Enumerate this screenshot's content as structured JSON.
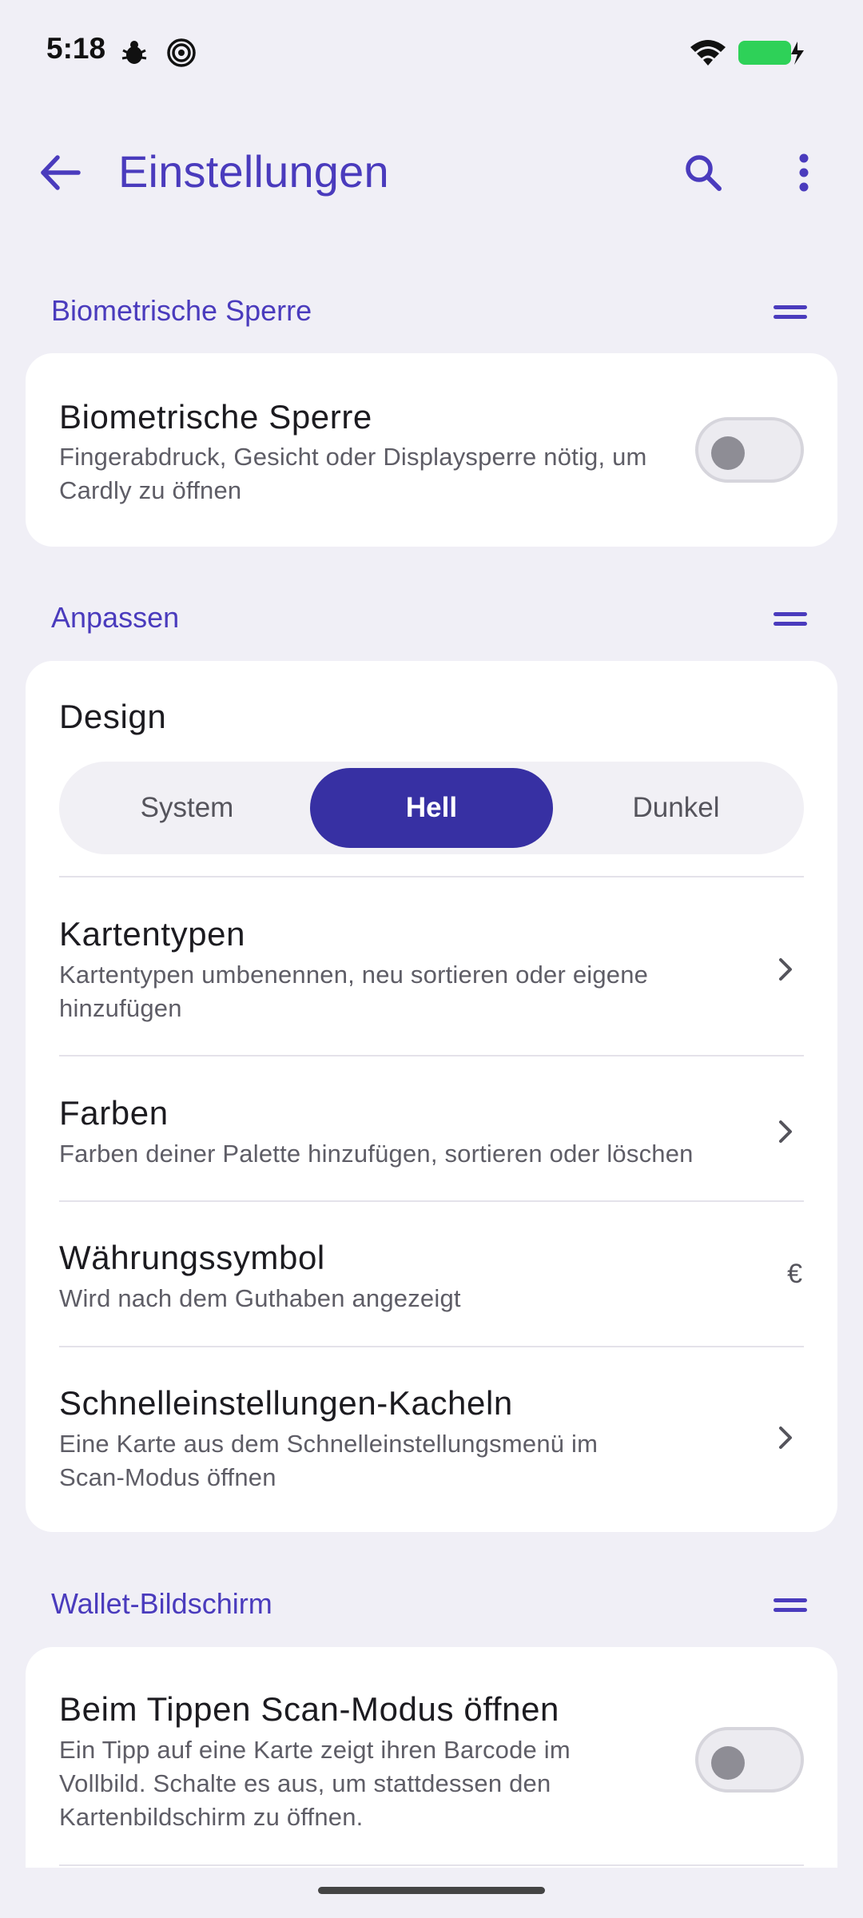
{
  "status_bar": {
    "time": "5:18",
    "icons": [
      "bug-icon",
      "hotspot-icon",
      "wifi-icon",
      "battery-charging-icon"
    ],
    "battery_color": "#2ed158"
  },
  "app_bar": {
    "title": "Einstellungen",
    "icons": [
      "back-arrow-icon",
      "search-icon",
      "more-vert-icon"
    ],
    "accent": "#4a3bbd"
  },
  "sections": {
    "biometric": {
      "header": "Biometrische Sperre",
      "item": {
        "title": "Biometrische Sperre",
        "subtitle_line1": "Fingerabdruck, Gesicht oder Displaysperre nötig, um",
        "subtitle_line2": "Cardly zu öffnen",
        "enabled": false
      }
    },
    "customize": {
      "header": "Anpassen",
      "design": {
        "label": "Design",
        "options": [
          "System",
          "Hell",
          "Dunkel"
        ],
        "selected": "Hell",
        "selected_color": "#3730a3"
      },
      "card_types": {
        "title": "Kartentypen",
        "subtitle_line1": "Kartentypen umbenennen, neu sortieren oder eigene",
        "subtitle_line2": "hinzufügen"
      },
      "colors": {
        "title": "Farben",
        "subtitle": "Farben deiner Palette hinzufügen, sortieren oder löschen"
      },
      "currency": {
        "title": "Währungssymbol",
        "subtitle": "Wird nach dem Guthaben angezeigt",
        "value": "€"
      },
      "quick_tiles": {
        "title": "Schnelleinstellungen-Kacheln",
        "subtitle_line1": "Eine Karte aus dem Schnelleinstellungsmenü im",
        "subtitle_line2": "Scan-Modus öffnen"
      }
    },
    "wallet": {
      "header": "Wallet-Bildschirm",
      "item": {
        "title": "Beim Tippen Scan-Modus öffnen",
        "subtitle_line1": "Ein Tipp auf eine Karte zeigt ihren Barcode im",
        "subtitle_line2": "Vollbild. Schalte es aus, um stattdessen den",
        "subtitle_line3": "Kartenbildschirm zu öffnen.",
        "enabled": false
      }
    }
  }
}
